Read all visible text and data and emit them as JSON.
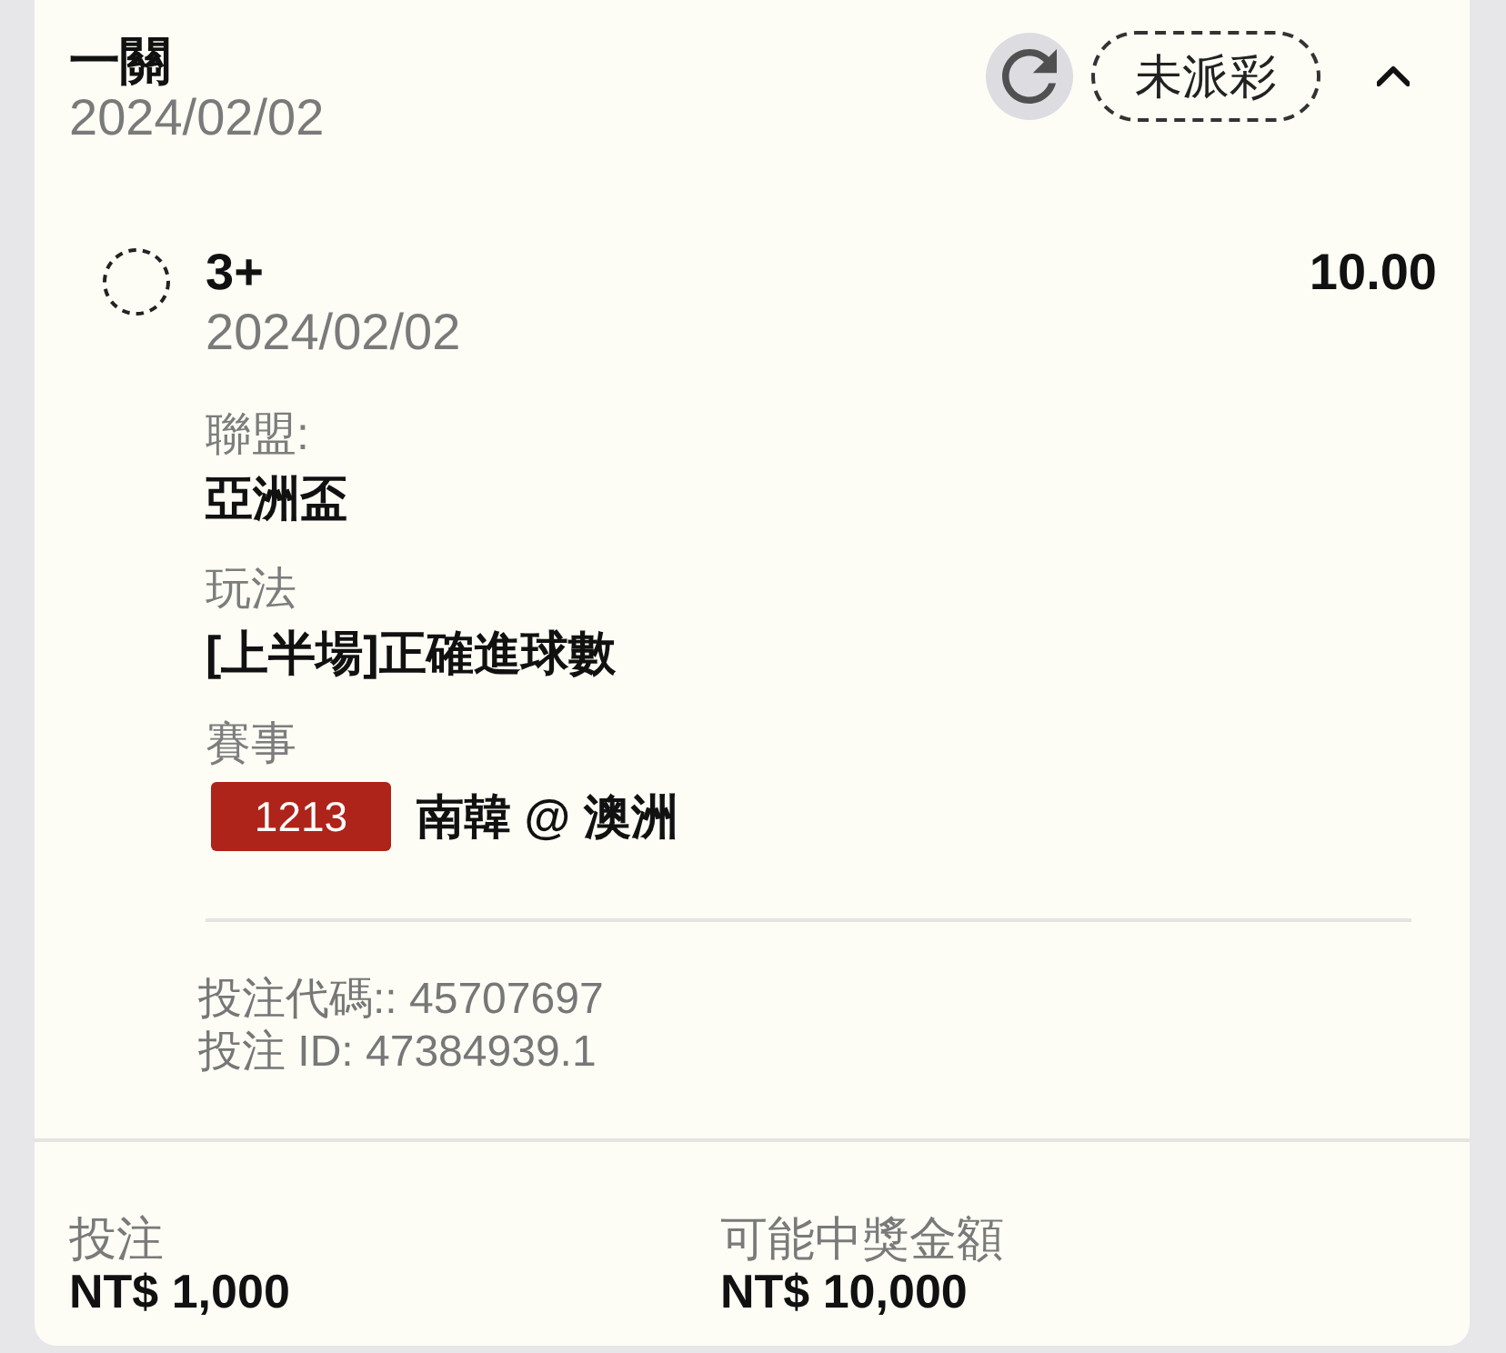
{
  "header": {
    "title": "一關",
    "date": "2024/02/02",
    "status": "未派彩",
    "expanded": true
  },
  "selection": {
    "name": "3+",
    "date": "2024/02/02",
    "odds": "10.00",
    "details": [
      {
        "label": "聯盟:",
        "value": "亞洲盃"
      },
      {
        "label": "玩法",
        "value": "[上半場]正確進球數"
      },
      {
        "label": "賽事",
        "match_code": "1213",
        "value": "南韓 @ 澳洲"
      }
    ],
    "references": [
      "投注代碼:: 45707697",
      "投注 ID: 47384939.1"
    ]
  },
  "summary": [
    {
      "label": "投注",
      "value": "NT$ 1,000"
    },
    {
      "label": "可能中獎金額",
      "value": "NT$ 10,000"
    }
  ]
}
